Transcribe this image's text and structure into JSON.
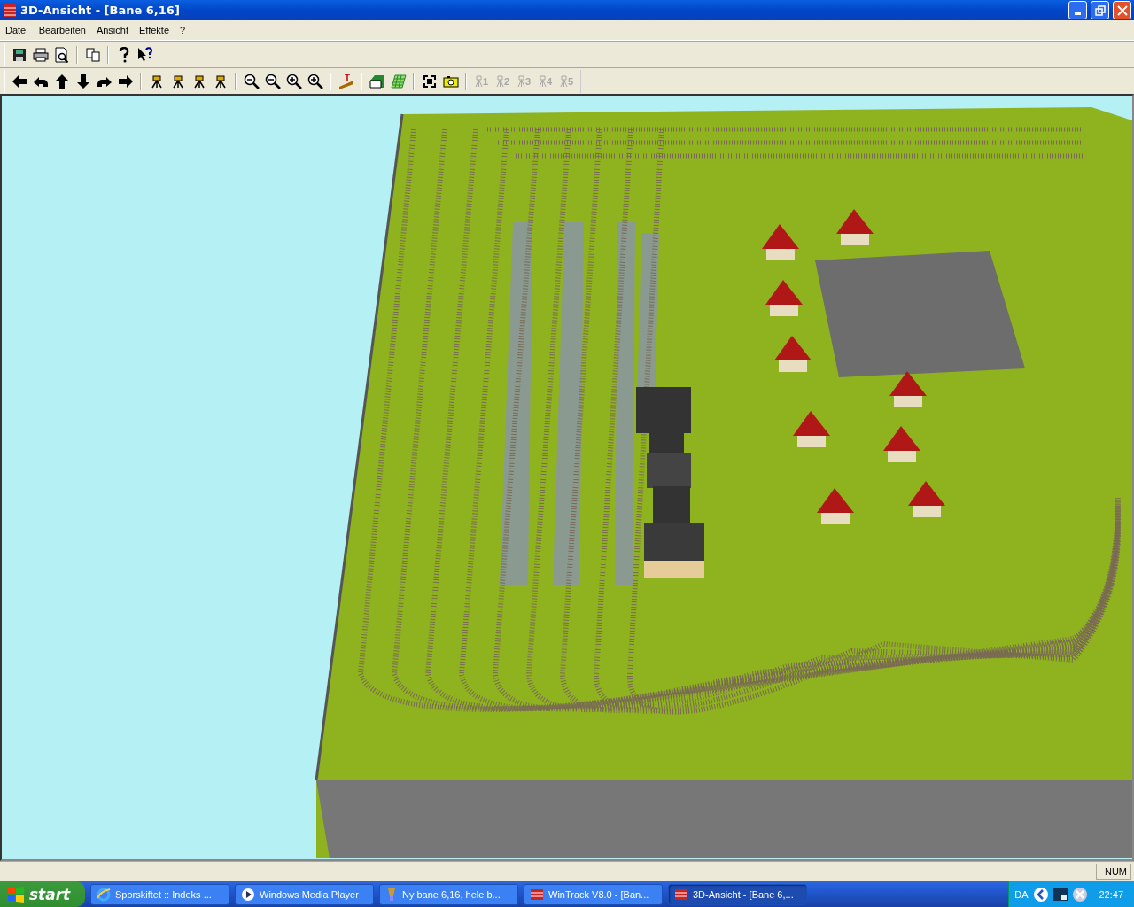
{
  "window": {
    "title": "3D-Ansicht - [Bane 6,16]"
  },
  "menu": [
    "Datei",
    "Bearbeiten",
    "Ansicht",
    "Effekte",
    "?"
  ],
  "toolbar_1": [
    {
      "kind": "save"
    },
    {
      "kind": "print"
    },
    {
      "kind": "preview"
    },
    {
      "kind": "sep"
    },
    {
      "kind": "copy"
    },
    {
      "kind": "sep"
    },
    {
      "kind": "help"
    },
    {
      "kind": "context-help"
    }
  ],
  "toolbar_2": [
    {
      "kind": "left"
    },
    {
      "kind": "back-left"
    },
    {
      "kind": "up"
    },
    {
      "kind": "down"
    },
    {
      "kind": "back-right"
    },
    {
      "kind": "right"
    },
    {
      "kind": "sep"
    },
    {
      "kind": "cam"
    },
    {
      "kind": "cam"
    },
    {
      "kind": "cam"
    },
    {
      "kind": "cam"
    },
    {
      "kind": "sep"
    },
    {
      "kind": "zoom-out2"
    },
    {
      "kind": "zoom-out"
    },
    {
      "kind": "zoom-in"
    },
    {
      "kind": "zoom-in2"
    },
    {
      "kind": "sep"
    },
    {
      "kind": "height"
    },
    {
      "kind": "sep"
    },
    {
      "kind": "terrain"
    },
    {
      "kind": "grid"
    },
    {
      "kind": "sep"
    },
    {
      "kind": "fit"
    },
    {
      "kind": "camera"
    },
    {
      "kind": "sep"
    },
    {
      "kind": "pos",
      "label": "1",
      "disabled": true
    },
    {
      "kind": "pos",
      "label": "2",
      "disabled": true
    },
    {
      "kind": "pos",
      "label": "3",
      "disabled": true
    },
    {
      "kind": "pos",
      "label": "4",
      "disabled": true
    },
    {
      "kind": "pos",
      "label": "5",
      "disabled": true
    }
  ],
  "status_bar": {
    "indicator": "NUM"
  },
  "taskbar": {
    "start": "start",
    "items": [
      {
        "label": "Sporskiftet :: Indeks ...",
        "kind": "browser",
        "selected": false
      },
      {
        "label": "Windows Media Player",
        "kind": "media",
        "selected": false
      },
      {
        "label": "Ny bane 6,16, hele b...",
        "kind": "paint",
        "selected": false
      },
      {
        "label": "WinTrack  V8.0 - [Ban...",
        "kind": "app",
        "selected": false
      },
      {
        "label": "3D-Ansicht - [Bane 6,...",
        "kind": "app",
        "selected": true
      }
    ],
    "language": "DA",
    "clock": "22:47"
  }
}
